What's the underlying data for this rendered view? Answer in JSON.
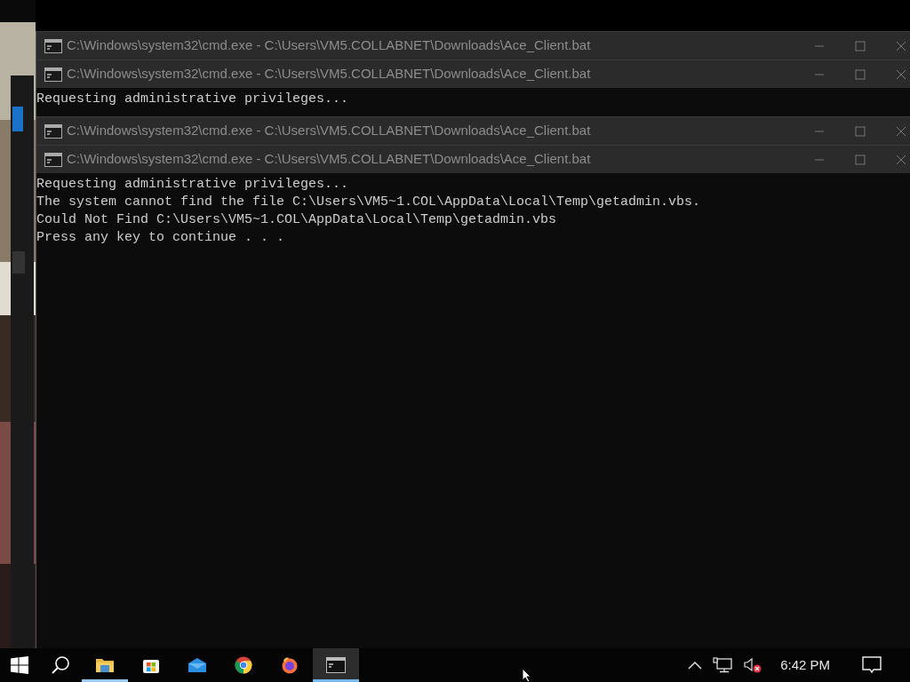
{
  "windows": [
    {
      "title": "C:\\Windows\\system32\\cmd.exe - C:\\Users\\VM5.COLLABNET\\Downloads\\Ace_Client.bat"
    },
    {
      "title": "C:\\Windows\\system32\\cmd.exe - C:\\Users\\VM5.COLLABNET\\Downloads\\Ace_Client.bat",
      "lines": [
        "Requesting administrative privileges..."
      ]
    },
    {
      "title": "C:\\Windows\\system32\\cmd.exe - C:\\Users\\VM5.COLLABNET\\Downloads\\Ace_Client.bat"
    },
    {
      "title": "C:\\Windows\\system32\\cmd.exe - C:\\Users\\VM5.COLLABNET\\Downloads\\Ace_Client.bat",
      "lines": [
        "Requesting administrative privileges...",
        "The system cannot find the file C:\\Users\\VM5~1.COL\\AppData\\Local\\Temp\\getadmin.vbs.",
        "Could Not Find C:\\Users\\VM5~1.COL\\AppData\\Local\\Temp\\getadmin.vbs",
        "Press any key to continue . . ."
      ]
    }
  ],
  "taskbar": {
    "apps": [
      {
        "kind": "explorer",
        "running": true,
        "selected": false
      },
      {
        "kind": "store",
        "running": false,
        "selected": false
      },
      {
        "kind": "mail",
        "running": false,
        "selected": false
      },
      {
        "kind": "chrome",
        "running": false,
        "selected": false
      },
      {
        "kind": "firefox",
        "running": false,
        "selected": false
      },
      {
        "kind": "console",
        "running": true,
        "selected": true
      }
    ],
    "clock": "6:42 PM"
  }
}
